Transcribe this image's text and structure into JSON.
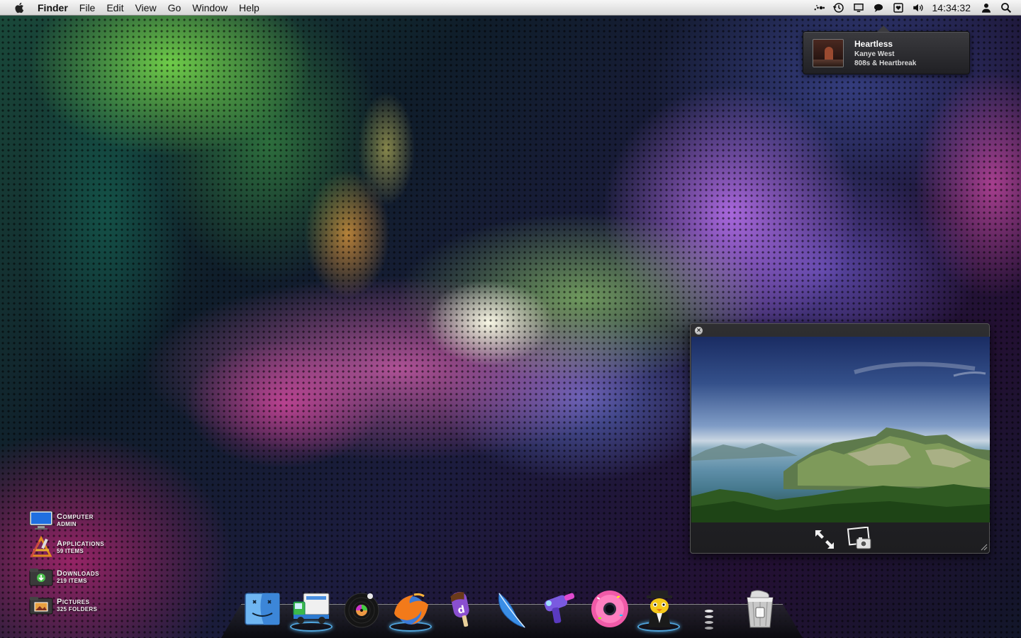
{
  "menubar": {
    "app_name": "Finder",
    "menus": [
      "File",
      "Edit",
      "View",
      "Go",
      "Window",
      "Help"
    ],
    "status_icons": [
      "bluetooth-dots-icon",
      "time-machine-icon",
      "display-icon",
      "chat-icon",
      "heart-tray-icon",
      "volume-icon"
    ],
    "clock": "14:34:32"
  },
  "now_playing": {
    "title": "Heartless",
    "artist": "Kanye West",
    "album": "808s & Heartbreak"
  },
  "shortcuts": [
    {
      "title": "Computer",
      "subtitle": "Admin",
      "icon": "monitor-icon"
    },
    {
      "title": "Applications",
      "subtitle": "59 items",
      "icon": "applications-icon"
    },
    {
      "title": "Downloads",
      "subtitle": "219 items",
      "icon": "downloads-folder-icon"
    },
    {
      "title": "Pictures",
      "subtitle": "325 folders",
      "icon": "pictures-folder-icon"
    }
  ],
  "dock": {
    "items": [
      "finder-icon",
      "delivery-truck-icon",
      "record-player-icon",
      "firefox-globe-icon",
      "ice-pop-icon",
      "feather-quill-icon",
      "ray-gun-icon",
      "donut-itunes-icon",
      "penguin-adium-icon",
      "trash-icon"
    ]
  },
  "colors": {
    "menubar_bg": "#e6e6e6",
    "popup_bg": "#2c2c30",
    "running_glow": "#5abeff"
  }
}
